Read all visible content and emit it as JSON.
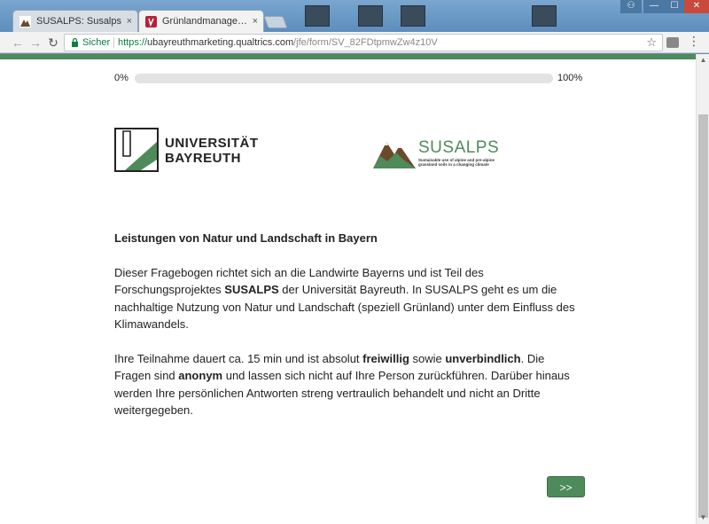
{
  "browser": {
    "tabs": [
      {
        "label": "SUSALPS: Susalps",
        "close": "×"
      },
      {
        "label": "Grünlandmanagement u",
        "close": "×"
      }
    ],
    "address": {
      "secure_label": "Sicher",
      "url_scheme": "https://",
      "url_host": "ubayreuthmarketing.qualtrics.com",
      "url_path": "/jfe/form/SV_82FDtpmwZw4z10V"
    },
    "nav": {
      "back": "←",
      "forward": "→",
      "reload": "↻",
      "star": "☆",
      "menu": "⋮"
    },
    "window": {
      "minimize": "—",
      "maximize": "☐",
      "close": "✕",
      "user": "⚇"
    }
  },
  "survey": {
    "progress": {
      "start_label": "0%",
      "end_label": "100%",
      "value": 0
    },
    "logos": {
      "university_line1": "UNIVERSITÄT",
      "university_line2": "BAYREUTH",
      "susalps_name": "SUSALPS",
      "susalps_tagline": "Sustainable use of alpine and pre-alpine grassland soils in a changing climate"
    },
    "heading": "Leistungen von Natur und Landschaft in Bayern",
    "paragraph1": {
      "part1": "Dieser Fragebogen richtet sich an die Landwirte Bayerns und ist Teil des Forschungsprojektes ",
      "bold1": "SUSALPS",
      "part2": " der Universität Bayreuth. In SUSALPS geht es um die nachhaltige Nutzung von Natur und Landschaft (speziell Grünland) unter dem Einfluss des Klimawandels."
    },
    "paragraph2": {
      "part1": "Ihre Teilnahme dauert ca. 15 min und ist absolut ",
      "bold1": "freiwillig",
      "part2": " sowie ",
      "bold2": "unverbindlich",
      "part3": ". Die Fragen sind ",
      "bold3": "anonym",
      "part4": " und lassen sich nicht auf Ihre Person zurückführen. Darüber hinaus werden Ihre persönlichen Antworten streng vertraulich behandelt und nicht an Dritte weitergegeben."
    },
    "next_button": ">>"
  },
  "colors": {
    "brand_green": "#4f8a5b",
    "secure_green": "#0b8043"
  }
}
